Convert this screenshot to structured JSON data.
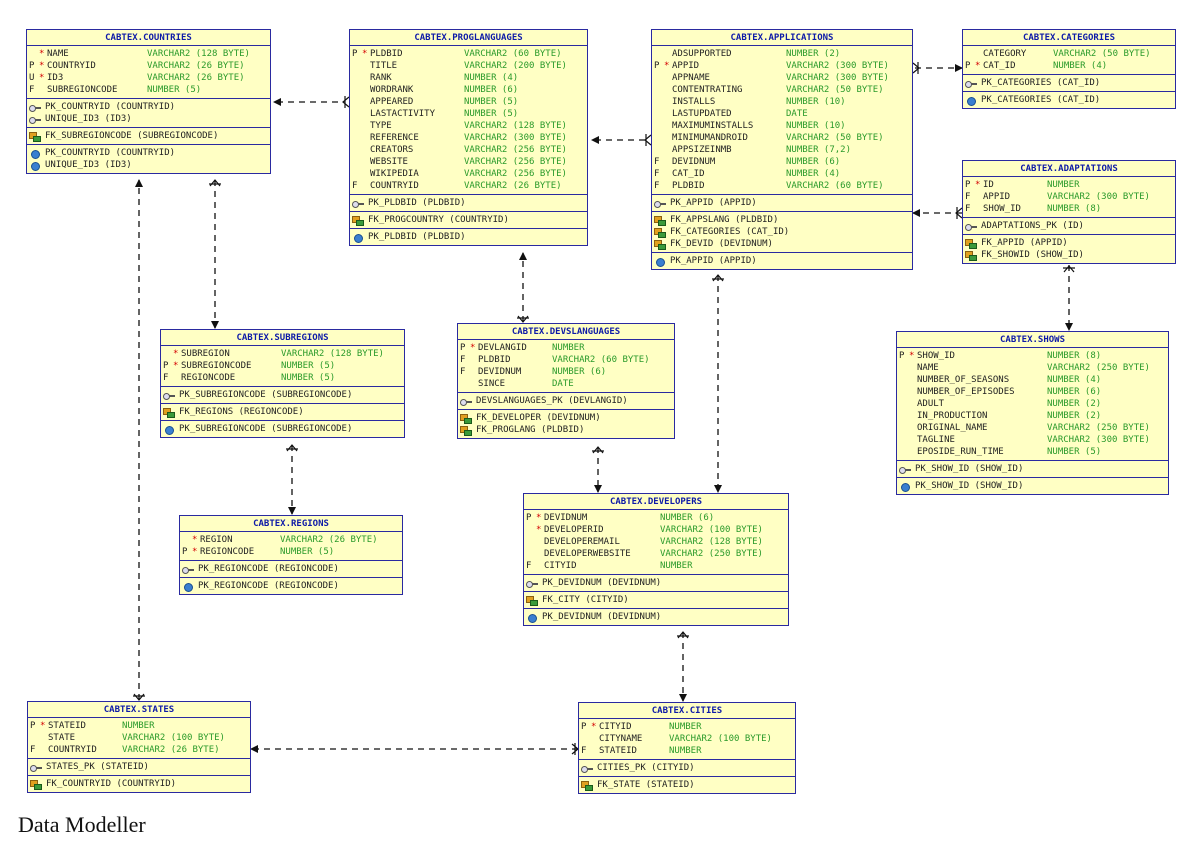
{
  "caption": "Data Modeller",
  "entities": {
    "countries": {
      "title": "CABTEX.COUNTRIES",
      "cols": [
        {
          "k": "",
          "m": "*",
          "n": "NAME",
          "t": "VARCHAR2 (128 BYTE)"
        },
        {
          "k": "P",
          "m": "*",
          "n": "COUNTRYID",
          "t": "VARCHAR2 (26 BYTE)"
        },
        {
          "k": "U",
          "m": "*",
          "n": "ID3",
          "t": "VARCHAR2 (26 BYTE)"
        },
        {
          "k": "F",
          "m": "",
          "n": "SUBREGIONCODE",
          "t": "NUMBER (5)"
        }
      ],
      "keys": [
        "PK_COUNTRYID (COUNTRYID)",
        "UNIQUE_ID3 (ID3)"
      ],
      "fks": [
        "FK_SUBREGIONCODE (SUBREGIONCODE)"
      ],
      "idx": [
        "PK_COUNTRYID (COUNTRYID)",
        "UNIQUE_ID3 (ID3)"
      ]
    },
    "proglanguages": {
      "title": "CABTEX.PROGLANGUAGES",
      "cols": [
        {
          "k": "P",
          "m": "*",
          "n": "PLDBID",
          "t": "VARCHAR2 (60 BYTE)"
        },
        {
          "k": "",
          "m": "",
          "n": "TITLE",
          "t": "VARCHAR2 (200 BYTE)"
        },
        {
          "k": "",
          "m": "",
          "n": "RANK",
          "t": "NUMBER (4)"
        },
        {
          "k": "",
          "m": "",
          "n": "WORDRANK",
          "t": "NUMBER (6)"
        },
        {
          "k": "",
          "m": "",
          "n": "APPEARED",
          "t": "NUMBER (5)"
        },
        {
          "k": "",
          "m": "",
          "n": "LASTACTIVITY",
          "t": "NUMBER (5)"
        },
        {
          "k": "",
          "m": "",
          "n": "TYPE",
          "t": "VARCHAR2 (128 BYTE)"
        },
        {
          "k": "",
          "m": "",
          "n": "REFERENCE",
          "t": "VARCHAR2 (300 BYTE)"
        },
        {
          "k": "",
          "m": "",
          "n": "CREATORS",
          "t": "VARCHAR2 (256 BYTE)"
        },
        {
          "k": "",
          "m": "",
          "n": "WEBSITE",
          "t": "VARCHAR2 (256 BYTE)"
        },
        {
          "k": "",
          "m": "",
          "n": "WIKIPEDIA",
          "t": "VARCHAR2 (256 BYTE)"
        },
        {
          "k": "F",
          "m": "",
          "n": "COUNTRYID",
          "t": "VARCHAR2 (26 BYTE)"
        }
      ],
      "keys": [
        "PK_PLDBID (PLDBID)"
      ],
      "fks": [
        "FK_PROGCOUNTRY (COUNTRYID)"
      ],
      "idx": [
        "PK_PLDBID (PLDBID)"
      ]
    },
    "applications": {
      "title": "CABTEX.APPLICATIONS",
      "cols": [
        {
          "k": "",
          "m": "",
          "n": "ADSUPPORTED",
          "t": "NUMBER (2)"
        },
        {
          "k": "P",
          "m": "*",
          "n": "APPID",
          "t": "VARCHAR2 (300 BYTE)"
        },
        {
          "k": "",
          "m": "",
          "n": "APPNAME",
          "t": "VARCHAR2 (300 BYTE)"
        },
        {
          "k": "",
          "m": "",
          "n": "CONTENTRATING",
          "t": "VARCHAR2 (50 BYTE)"
        },
        {
          "k": "",
          "m": "",
          "n": "INSTALLS",
          "t": "NUMBER (10)"
        },
        {
          "k": "",
          "m": "",
          "n": "LASTUPDATED",
          "t": "DATE"
        },
        {
          "k": "",
          "m": "",
          "n": "MAXIMUMINSTALLS",
          "t": "NUMBER (10)"
        },
        {
          "k": "",
          "m": "",
          "n": "MINIMUMANDROID",
          "t": "VARCHAR2 (50 BYTE)"
        },
        {
          "k": "",
          "m": "",
          "n": "APPSIZEINMB",
          "t": "NUMBER (7,2)"
        },
        {
          "k": "F",
          "m": "",
          "n": "DEVIDNUM",
          "t": "NUMBER (6)"
        },
        {
          "k": "F",
          "m": "",
          "n": "CAT_ID",
          "t": "NUMBER (4)"
        },
        {
          "k": "F",
          "m": "",
          "n": "PLDBID",
          "t": "VARCHAR2 (60 BYTE)"
        }
      ],
      "keys": [
        "PK_APPID (APPID)"
      ],
      "fks": [
        "FK_APPSLANG (PLDBID)",
        "FK_CATEGORIES (CAT_ID)",
        "FK_DEVID (DEVIDNUM)"
      ],
      "idx": [
        "PK_APPID (APPID)"
      ]
    },
    "categories": {
      "title": "CABTEX.CATEGORIES",
      "cols": [
        {
          "k": "",
          "m": "",
          "n": "CATEGORY",
          "t": "VARCHAR2 (50 BYTE)"
        },
        {
          "k": "P",
          "m": "*",
          "n": "CAT_ID",
          "t": "NUMBER (4)"
        }
      ],
      "keys": [
        "PK_CATEGORIES (CAT_ID)"
      ],
      "fks": [],
      "idx": [
        "PK_CATEGORIES (CAT_ID)"
      ]
    },
    "adaptations": {
      "title": "CABTEX.ADAPTATIONS",
      "cols": [
        {
          "k": "P",
          "m": "*",
          "n": "ID",
          "t": "NUMBER"
        },
        {
          "k": "F",
          "m": "",
          "n": "APPID",
          "t": "VARCHAR2 (300 BYTE)"
        },
        {
          "k": "F",
          "m": "",
          "n": "SHOW_ID",
          "t": "NUMBER (8)"
        }
      ],
      "keys": [
        "ADAPTATIONS_PK (ID)"
      ],
      "fks": [
        "FK_APPID (APPID)",
        "FK_SHOWID (SHOW_ID)"
      ],
      "idx": []
    },
    "shows": {
      "title": "CABTEX.SHOWS",
      "cols": [
        {
          "k": "P",
          "m": "*",
          "n": "SHOW_ID",
          "t": "NUMBER (8)"
        },
        {
          "k": "",
          "m": "",
          "n": "NAME",
          "t": "VARCHAR2 (250 BYTE)"
        },
        {
          "k": "",
          "m": "",
          "n": "NUMBER_OF_SEASONS",
          "t": "NUMBER (4)"
        },
        {
          "k": "",
          "m": "",
          "n": "NUMBER_OF_EPISODES",
          "t": "NUMBER (6)"
        },
        {
          "k": "",
          "m": "",
          "n": "ADULT",
          "t": "NUMBER (2)"
        },
        {
          "k": "",
          "m": "",
          "n": "IN_PRODUCTION",
          "t": "NUMBER (2)"
        },
        {
          "k": "",
          "m": "",
          "n": "ORIGINAL_NAME",
          "t": "VARCHAR2 (250 BYTE)"
        },
        {
          "k": "",
          "m": "",
          "n": "TAGLINE",
          "t": "VARCHAR2 (300 BYTE)"
        },
        {
          "k": "",
          "m": "",
          "n": "EPOSIDE_RUN_TIME",
          "t": "NUMBER (5)"
        }
      ],
      "keys": [
        "PK_SHOW_ID (SHOW_ID)"
      ],
      "fks": [],
      "idx": [
        "PK_SHOW_ID (SHOW_ID)"
      ]
    },
    "subregions": {
      "title": "CABTEX.SUBREGIONS",
      "cols": [
        {
          "k": "",
          "m": "*",
          "n": "SUBREGION",
          "t": "VARCHAR2 (128 BYTE)"
        },
        {
          "k": "P",
          "m": "*",
          "n": "SUBREGIONCODE",
          "t": "NUMBER (5)"
        },
        {
          "k": "F",
          "m": "",
          "n": "REGIONCODE",
          "t": "NUMBER (5)"
        }
      ],
      "keys": [
        "PK_SUBREGIONCODE (SUBREGIONCODE)"
      ],
      "fks": [
        "FK_REGIONS (REGIONCODE)"
      ],
      "idx": [
        "PK_SUBREGIONCODE (SUBREGIONCODE)"
      ]
    },
    "devslanguages": {
      "title": "CABTEX.DEVSLANGUAGES",
      "cols": [
        {
          "k": "P",
          "m": "*",
          "n": "DEVLANGID",
          "t": "NUMBER"
        },
        {
          "k": "F",
          "m": "",
          "n": "PLDBID",
          "t": "VARCHAR2 (60 BYTE)"
        },
        {
          "k": "F",
          "m": "",
          "n": "DEVIDNUM",
          "t": "NUMBER (6)"
        },
        {
          "k": "",
          "m": "",
          "n": "SINCE",
          "t": "DATE"
        }
      ],
      "keys": [
        "DEVSLANGUAGES_PK (DEVLANGID)"
      ],
      "fks": [
        "FK_DEVELOPER (DEVIDNUM)",
        "FK_PROGLANG (PLDBID)"
      ],
      "idx": []
    },
    "regions": {
      "title": "CABTEX.REGIONS",
      "cols": [
        {
          "k": "",
          "m": "*",
          "n": "REGION",
          "t": "VARCHAR2 (26 BYTE)"
        },
        {
          "k": "P",
          "m": "*",
          "n": "REGIONCODE",
          "t": "NUMBER (5)"
        }
      ],
      "keys": [
        "PK_REGIONCODE (REGIONCODE)"
      ],
      "fks": [],
      "idx": [
        "PK_REGIONCODE (REGIONCODE)"
      ]
    },
    "developers": {
      "title": "CABTEX.DEVELOPERS",
      "cols": [
        {
          "k": "P",
          "m": "*",
          "n": "DEVIDNUM",
          "t": "NUMBER (6)"
        },
        {
          "k": "",
          "m": "*",
          "n": "DEVELOPERID",
          "t": "VARCHAR2 (100 BYTE)"
        },
        {
          "k": "",
          "m": "",
          "n": "DEVELOPEREMAIL",
          "t": "VARCHAR2 (128 BYTE)"
        },
        {
          "k": "",
          "m": "",
          "n": "DEVELOPERWEBSITE",
          "t": "VARCHAR2 (250 BYTE)"
        },
        {
          "k": "F",
          "m": "",
          "n": "CITYID",
          "t": "NUMBER"
        }
      ],
      "keys": [
        "PK_DEVIDNUM (DEVIDNUM)"
      ],
      "fks": [
        "FK_CITY (CITYID)"
      ],
      "idx": [
        "PK_DEVIDNUM (DEVIDNUM)"
      ]
    },
    "states": {
      "title": "CABTEX.STATES",
      "cols": [
        {
          "k": "P",
          "m": "*",
          "n": "STATEID",
          "t": "NUMBER"
        },
        {
          "k": "",
          "m": "",
          "n": "STATE",
          "t": "VARCHAR2 (100 BYTE)"
        },
        {
          "k": "F",
          "m": "",
          "n": "COUNTRYID",
          "t": "VARCHAR2 (26 BYTE)"
        }
      ],
      "keys": [
        "STATES_PK (STATEID)"
      ],
      "fks": [
        "FK_COUNTRYID (COUNTRYID)"
      ],
      "idx": []
    },
    "cities": {
      "title": "CABTEX.CITIES",
      "cols": [
        {
          "k": "P",
          "m": "*",
          "n": "CITYID",
          "t": "NUMBER"
        },
        {
          "k": "",
          "m": "",
          "n": "CITYNAME",
          "t": "VARCHAR2 (100 BYTE)"
        },
        {
          "k": "F",
          "m": "",
          "n": "STATEID",
          "t": "NUMBER"
        }
      ],
      "keys": [
        "CITIES_PK (CITYID)"
      ],
      "fks": [
        "FK_STATE (STATEID)"
      ],
      "idx": []
    }
  },
  "colors": {
    "box_fill": "#ffffc4",
    "border": "#2a2aa0",
    "title": "#0d1aa8",
    "type": "#2a9a2a",
    "mandatory": "#d40000",
    "link": "#222222"
  }
}
